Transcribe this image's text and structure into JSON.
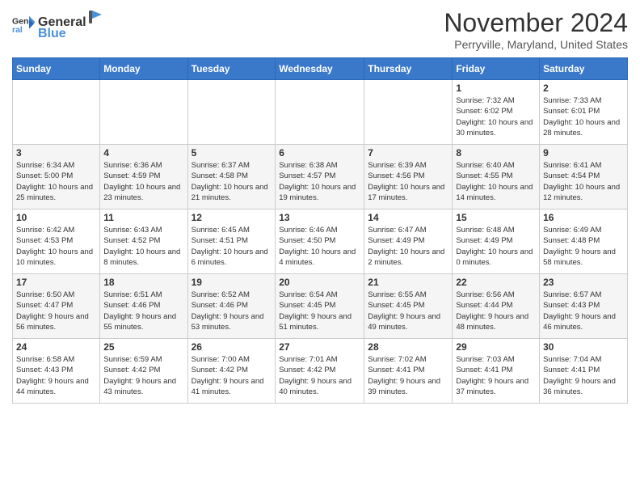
{
  "header": {
    "logo": {
      "general": "General",
      "blue": "Blue"
    },
    "title": "November 2024",
    "location": "Perryville, Maryland, United States"
  },
  "calendar": {
    "days_of_week": [
      "Sunday",
      "Monday",
      "Tuesday",
      "Wednesday",
      "Thursday",
      "Friday",
      "Saturday"
    ],
    "weeks": [
      [
        {
          "day": "",
          "detail": ""
        },
        {
          "day": "",
          "detail": ""
        },
        {
          "day": "",
          "detail": ""
        },
        {
          "day": "",
          "detail": ""
        },
        {
          "day": "",
          "detail": ""
        },
        {
          "day": "1",
          "detail": "Sunrise: 7:32 AM\nSunset: 6:02 PM\nDaylight: 10 hours and 30 minutes."
        },
        {
          "day": "2",
          "detail": "Sunrise: 7:33 AM\nSunset: 6:01 PM\nDaylight: 10 hours and 28 minutes."
        }
      ],
      [
        {
          "day": "3",
          "detail": "Sunrise: 6:34 AM\nSunset: 5:00 PM\nDaylight: 10 hours and 25 minutes."
        },
        {
          "day": "4",
          "detail": "Sunrise: 6:36 AM\nSunset: 4:59 PM\nDaylight: 10 hours and 23 minutes."
        },
        {
          "day": "5",
          "detail": "Sunrise: 6:37 AM\nSunset: 4:58 PM\nDaylight: 10 hours and 21 minutes."
        },
        {
          "day": "6",
          "detail": "Sunrise: 6:38 AM\nSunset: 4:57 PM\nDaylight: 10 hours and 19 minutes."
        },
        {
          "day": "7",
          "detail": "Sunrise: 6:39 AM\nSunset: 4:56 PM\nDaylight: 10 hours and 17 minutes."
        },
        {
          "day": "8",
          "detail": "Sunrise: 6:40 AM\nSunset: 4:55 PM\nDaylight: 10 hours and 14 minutes."
        },
        {
          "day": "9",
          "detail": "Sunrise: 6:41 AM\nSunset: 4:54 PM\nDaylight: 10 hours and 12 minutes."
        }
      ],
      [
        {
          "day": "10",
          "detail": "Sunrise: 6:42 AM\nSunset: 4:53 PM\nDaylight: 10 hours and 10 minutes."
        },
        {
          "day": "11",
          "detail": "Sunrise: 6:43 AM\nSunset: 4:52 PM\nDaylight: 10 hours and 8 minutes."
        },
        {
          "day": "12",
          "detail": "Sunrise: 6:45 AM\nSunset: 4:51 PM\nDaylight: 10 hours and 6 minutes."
        },
        {
          "day": "13",
          "detail": "Sunrise: 6:46 AM\nSunset: 4:50 PM\nDaylight: 10 hours and 4 minutes."
        },
        {
          "day": "14",
          "detail": "Sunrise: 6:47 AM\nSunset: 4:49 PM\nDaylight: 10 hours and 2 minutes."
        },
        {
          "day": "15",
          "detail": "Sunrise: 6:48 AM\nSunset: 4:49 PM\nDaylight: 10 hours and 0 minutes."
        },
        {
          "day": "16",
          "detail": "Sunrise: 6:49 AM\nSunset: 4:48 PM\nDaylight: 9 hours and 58 minutes."
        }
      ],
      [
        {
          "day": "17",
          "detail": "Sunrise: 6:50 AM\nSunset: 4:47 PM\nDaylight: 9 hours and 56 minutes."
        },
        {
          "day": "18",
          "detail": "Sunrise: 6:51 AM\nSunset: 4:46 PM\nDaylight: 9 hours and 55 minutes."
        },
        {
          "day": "19",
          "detail": "Sunrise: 6:52 AM\nSunset: 4:46 PM\nDaylight: 9 hours and 53 minutes."
        },
        {
          "day": "20",
          "detail": "Sunrise: 6:54 AM\nSunset: 4:45 PM\nDaylight: 9 hours and 51 minutes."
        },
        {
          "day": "21",
          "detail": "Sunrise: 6:55 AM\nSunset: 4:45 PM\nDaylight: 9 hours and 49 minutes."
        },
        {
          "day": "22",
          "detail": "Sunrise: 6:56 AM\nSunset: 4:44 PM\nDaylight: 9 hours and 48 minutes."
        },
        {
          "day": "23",
          "detail": "Sunrise: 6:57 AM\nSunset: 4:43 PM\nDaylight: 9 hours and 46 minutes."
        }
      ],
      [
        {
          "day": "24",
          "detail": "Sunrise: 6:58 AM\nSunset: 4:43 PM\nDaylight: 9 hours and 44 minutes."
        },
        {
          "day": "25",
          "detail": "Sunrise: 6:59 AM\nSunset: 4:42 PM\nDaylight: 9 hours and 43 minutes."
        },
        {
          "day": "26",
          "detail": "Sunrise: 7:00 AM\nSunset: 4:42 PM\nDaylight: 9 hours and 41 minutes."
        },
        {
          "day": "27",
          "detail": "Sunrise: 7:01 AM\nSunset: 4:42 PM\nDaylight: 9 hours and 40 minutes."
        },
        {
          "day": "28",
          "detail": "Sunrise: 7:02 AM\nSunset: 4:41 PM\nDaylight: 9 hours and 39 minutes."
        },
        {
          "day": "29",
          "detail": "Sunrise: 7:03 AM\nSunset: 4:41 PM\nDaylight: 9 hours and 37 minutes."
        },
        {
          "day": "30",
          "detail": "Sunrise: 7:04 AM\nSunset: 4:41 PM\nDaylight: 9 hours and 36 minutes."
        }
      ]
    ]
  }
}
